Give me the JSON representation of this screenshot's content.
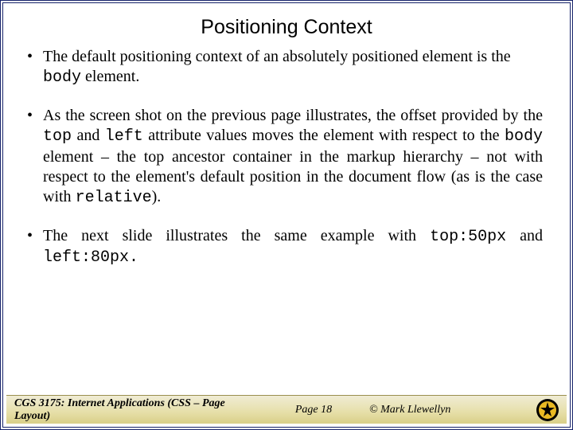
{
  "title": "Positioning Context",
  "bullets": {
    "b1a": "The default positioning context of an absolutely positioned element is the ",
    "b1code": "body",
    "b1b": " element.",
    "b2a": "As the screen shot on the previous page illustrates, the offset provided by the ",
    "b2code1": "top",
    "b2b": " and ",
    "b2code2": "left",
    "b2c": " attribute values moves the element with respect to the ",
    "b2code3": "body",
    "b2d": " element – the top ancestor container in the markup hierarchy – not with respect to the element's default position in the document flow (as is the case with ",
    "b2code4": "relative",
    "b2e": ").",
    "b3a": "The next slide illustrates the same example with ",
    "b3code1": "top:50px",
    "b3b": " and ",
    "b3code2": "left:80px.",
    "b3c": ""
  },
  "footer": {
    "course": "CGS 3175: Internet Applications (CSS – Page Layout)",
    "page": "Page 18",
    "author": "© Mark Llewellyn"
  }
}
